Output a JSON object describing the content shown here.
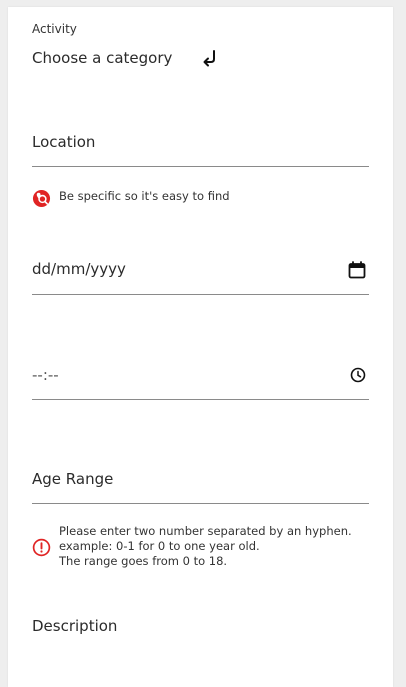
{
  "form": {
    "activity": {
      "label": "Activity",
      "selected": "Choose a category",
      "arrow_icon": "return-arrow-icon"
    },
    "location": {
      "placeholder": "Location",
      "hint": "Be specific so it's easy to find",
      "hint_icon": "search-location-icon",
      "hint_color": "#e02424"
    },
    "date": {
      "placeholder": "dd/mm/yyyy",
      "icon": "calendar-icon"
    },
    "time": {
      "placeholder": "--:--",
      "icon": "clock-icon"
    },
    "age_range": {
      "placeholder": "Age Range",
      "hint_lines": [
        "Please enter two number separated by an hyphen.",
        "example: 0-1 for 0 to one year old.",
        "The range goes from 0 to 18."
      ],
      "hint_icon": "alert-circle-icon",
      "hint_color": "#e02424"
    },
    "description": {
      "placeholder": "Description"
    }
  }
}
